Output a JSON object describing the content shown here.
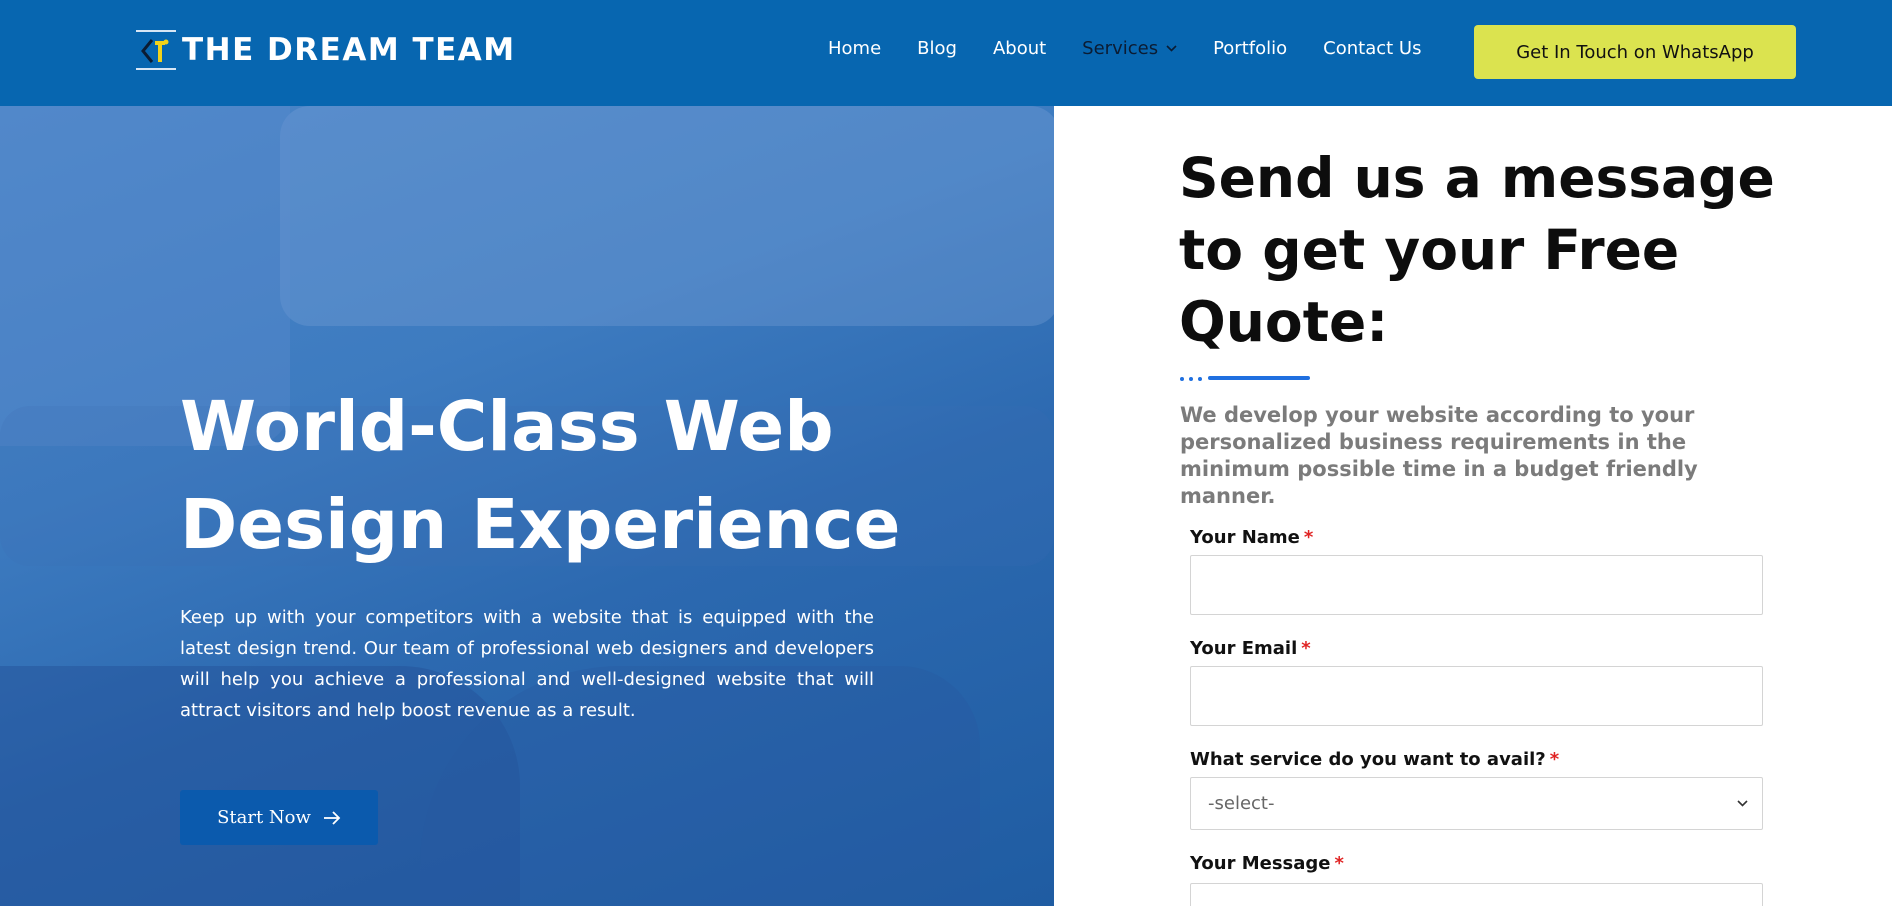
{
  "header": {
    "logo_text": "THE DREAM TEAM",
    "nav": [
      {
        "label": "Home",
        "active": false
      },
      {
        "label": "Blog",
        "active": false
      },
      {
        "label": "About",
        "active": false
      },
      {
        "label": "Services",
        "active": true,
        "has_dropdown": true
      },
      {
        "label": "Portfolio",
        "active": false
      },
      {
        "label": "Contact Us",
        "active": false
      }
    ],
    "cta_label": "Get In Touch on WhatsApp"
  },
  "hero": {
    "title": "World-Class Web Design Experience",
    "text": "Keep up with your competitors with a website that is equipped with the latest design trend. Our team of professional web designers and developers will help you achieve a professional and well-designed website that will attract visitors and help boost revenue as a result.",
    "button_label": "Start Now"
  },
  "form": {
    "title": "Send us a message to get your Free Quote:",
    "intro": "We develop your website according to your personalized business requirements in the minimum possible time in a budget friendly manner.",
    "fields": {
      "name_label": "Your Name",
      "email_label": "Your Email",
      "service_label": "What service do you want to avail?",
      "service_selected": "-select-",
      "message_label": "Your Message",
      "required_mark": "*"
    }
  },
  "colors": {
    "header_bg": "#0766b0",
    "cta_bg": "#dbe34f",
    "accent": "#1f6fe0",
    "button_bg": "#0b5aad",
    "required": "#e02424"
  },
  "icons": [
    "logo-mark-icon",
    "chevron-down-icon",
    "arrow-right-icon",
    "select-chevron-icon"
  ]
}
